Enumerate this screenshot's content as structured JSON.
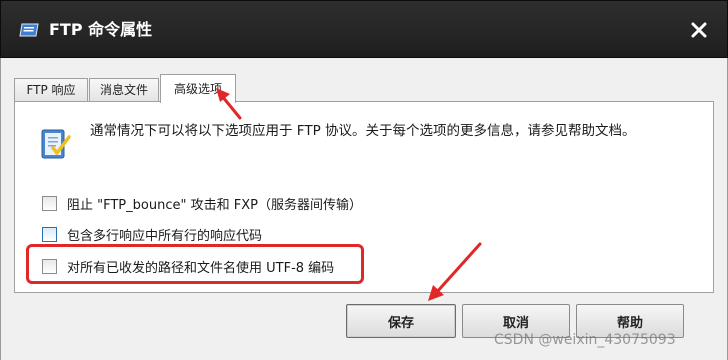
{
  "window": {
    "title": "FTP 命令属性",
    "icon": "ftp-app-icon",
    "close_icon": "close-icon"
  },
  "tabs": [
    {
      "label": "FTP 响应",
      "active": false
    },
    {
      "label": "消息文件",
      "active": false
    },
    {
      "label": "高级选项",
      "active": true
    }
  ],
  "panel": {
    "info_icon": "checklist-icon",
    "info_text": "通常情况下可以将以下选项应用于 FTP 协议。关于每个选项的更多信息，请参见帮助文档。",
    "options": [
      {
        "label": "阻止 \"FTP_bounce\" 攻击和 FXP（服务器间传输）",
        "checked": false
      },
      {
        "label": "包含多行响应中所有行的响应代码",
        "checked": false
      },
      {
        "label": "对所有已收发的路径和文件名使用 UTF-8 编码",
        "checked": false
      }
    ]
  },
  "buttons": {
    "save": "保存",
    "cancel": "取消",
    "help": "帮助"
  },
  "annotations": {
    "color": "#e02828"
  },
  "watermark": "CSDN @weixin_43075093"
}
